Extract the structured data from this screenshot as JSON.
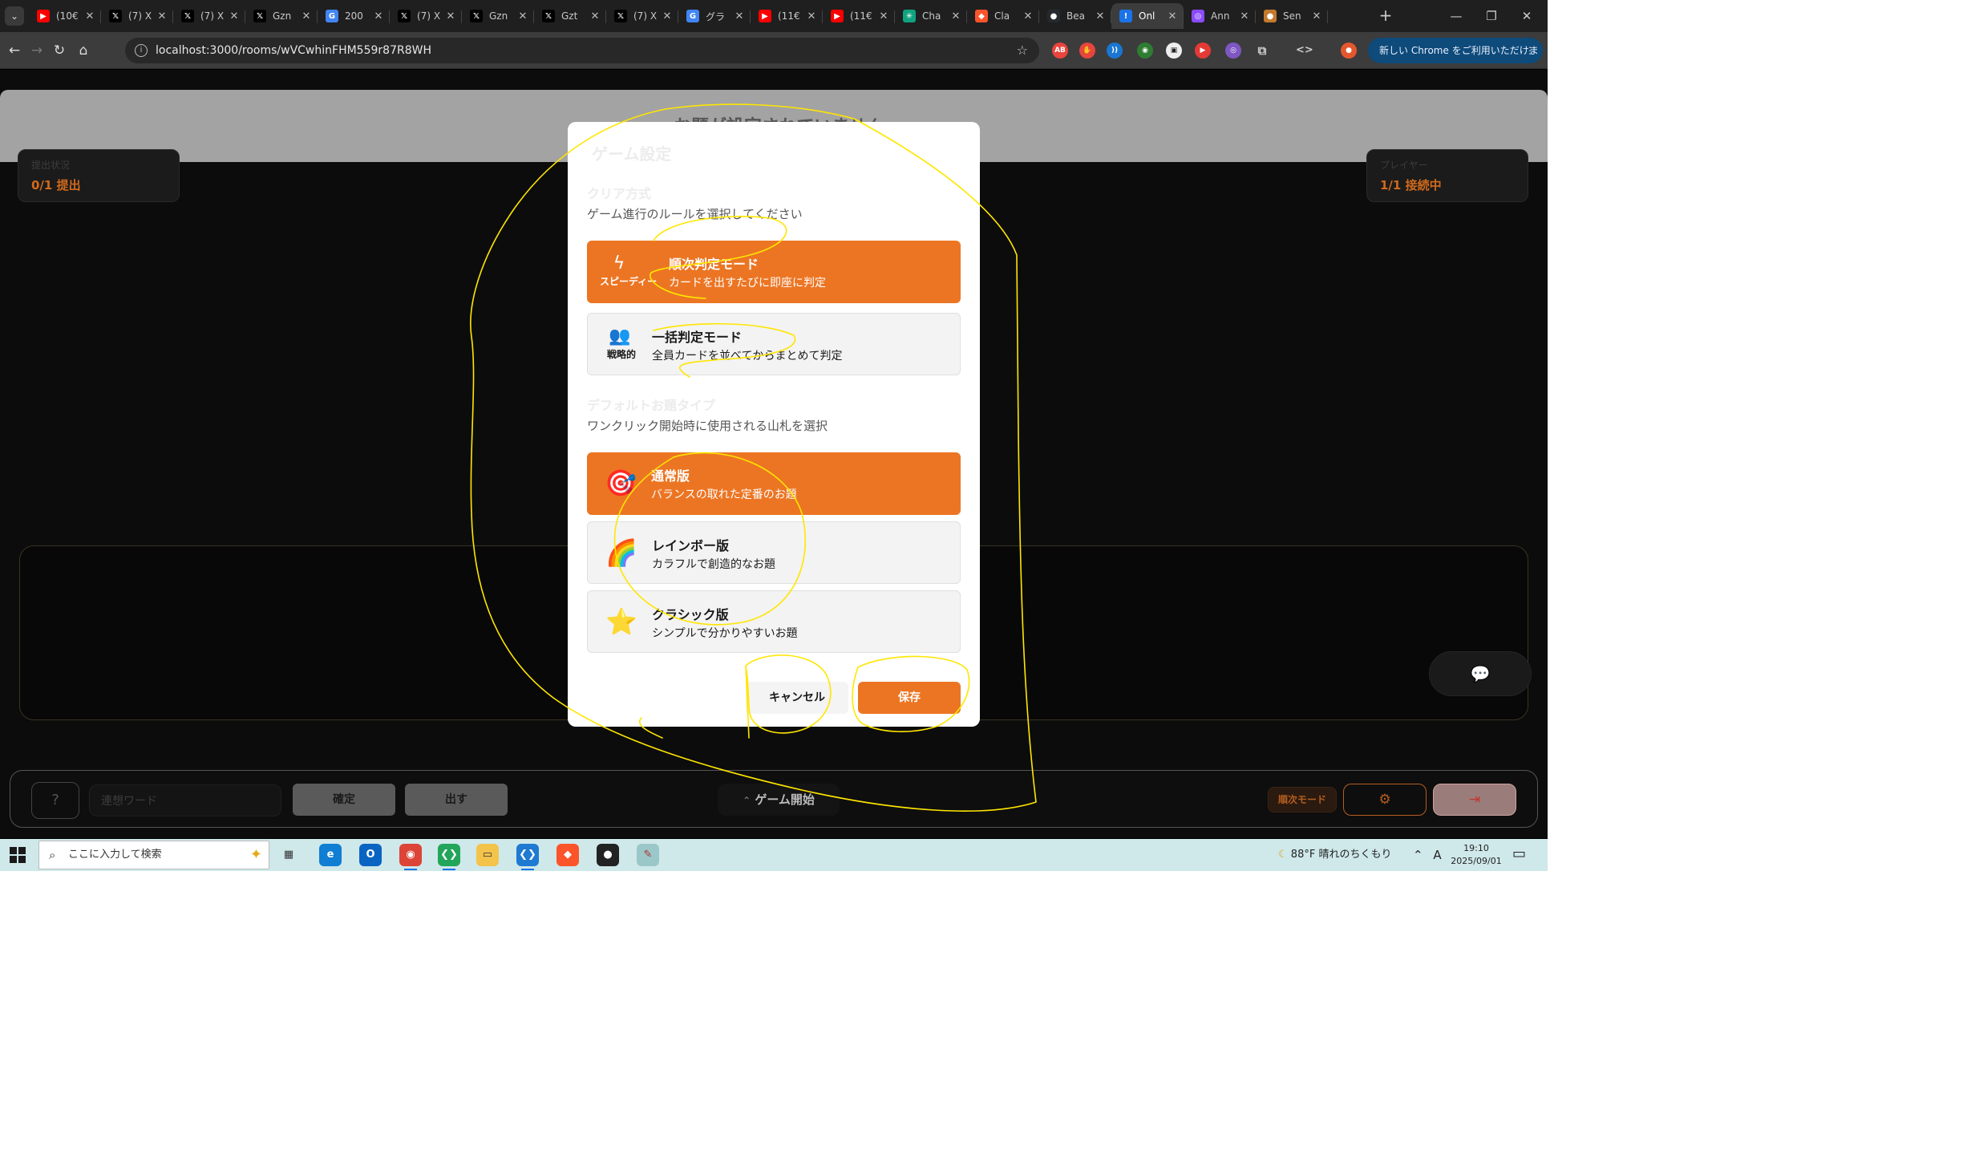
{
  "browser": {
    "tabs": [
      {
        "title": "(10€",
        "icon": "youtube-icon",
        "color": "#ff0000",
        "glyph": "▶"
      },
      {
        "title": "(7) X",
        "icon": "x-logo-icon",
        "color": "#000000",
        "glyph": "𝕏"
      },
      {
        "title": "(7) X",
        "icon": "x-logo-icon",
        "color": "#000000",
        "glyph": "𝕏"
      },
      {
        "title": "Gzn",
        "icon": "x-logo-icon",
        "color": "#000000",
        "glyph": "𝕏"
      },
      {
        "title": "200",
        "icon": "google-icon",
        "color": "#4285f4",
        "glyph": "G"
      },
      {
        "title": "(7) X",
        "icon": "x-logo-icon",
        "color": "#000000",
        "glyph": "𝕏"
      },
      {
        "title": "Gzn",
        "icon": "x-logo-icon",
        "color": "#000000",
        "glyph": "𝕏"
      },
      {
        "title": "Gzt",
        "icon": "x-logo-icon",
        "color": "#000000",
        "glyph": "𝕏"
      },
      {
        "title": "(7) X",
        "icon": "x-logo-icon",
        "color": "#000000",
        "glyph": "𝕏"
      },
      {
        "title": "グラ",
        "icon": "google-icon",
        "color": "#4285f4",
        "glyph": "G"
      },
      {
        "title": "(11€",
        "icon": "youtube-icon",
        "color": "#ff0000",
        "glyph": "▶"
      },
      {
        "title": "(11€",
        "icon": "youtube-icon",
        "color": "#ff0000",
        "glyph": "▶"
      },
      {
        "title": "Cha",
        "icon": "chatgpt-icon",
        "color": "#10a37f",
        "glyph": "✳"
      },
      {
        "title": "Cla",
        "icon": "brave-icon",
        "color": "#fb542b",
        "glyph": "◆"
      },
      {
        "title": "Bea",
        "icon": "github-icon",
        "color": "#24292e",
        "glyph": "●"
      },
      {
        "title": "Onl",
        "icon": "alert-icon",
        "color": "#1a73e8",
        "glyph": "!",
        "active": true
      },
      {
        "title": "Ann",
        "icon": "chrome-icon",
        "color": "#8a4bff",
        "glyph": "◎"
      },
      {
        "title": "Sen",
        "icon": "cookie-icon",
        "color": "#c47a2c",
        "glyph": "●"
      }
    ],
    "url": "localhost:3000/rooms/wVCwhinFHM559r87R8WH",
    "update_label": "新しい Chrome をご利用いただけます"
  },
  "game": {
    "background_title": "お題が設定されていません",
    "submit_card": {
      "label": "提出状況",
      "value": "0/1 提出"
    },
    "player_card": {
      "label": "プレイヤー",
      "value": "1/1 接続中"
    },
    "controls": {
      "help": "?",
      "word_placeholder": "連想ワード",
      "confirm": "確定",
      "play": "出す",
      "start": "ゲーム開始",
      "mode_badge": "順次モード"
    }
  },
  "modal": {
    "title": "ゲーム設定",
    "clear_section": {
      "title": "クリア方式",
      "desc": "ゲーム進行のルールを選択してください",
      "options": [
        {
          "tag": "スピーディー",
          "name": "順次判定モード",
          "desc": "カードを出すたびに即座に判定",
          "selected": true
        },
        {
          "tag": "戦略的",
          "name": "一括判定モード",
          "desc": "全員カードを並べてからまとめて判定",
          "selected": false
        }
      ]
    },
    "deck_section": {
      "title": "デフォルトお題タイプ",
      "desc": "ワンクリック開始時に使用される山札を選択",
      "options": [
        {
          "icon": "🎯",
          "name": "通常版",
          "desc": "バランスの取れた定番のお題",
          "selected": true
        },
        {
          "icon": "🌈",
          "name": "レインボー版",
          "desc": "カラフルで創造的なお題",
          "selected": false
        },
        {
          "icon": "⭐",
          "name": "クラシック版",
          "desc": "シンプルで分かりやすいお題",
          "selected": false
        }
      ]
    },
    "cancel": "キャンセル",
    "save": "保存"
  },
  "taskbar": {
    "search_placeholder": "ここに入力して検索",
    "weather": "88°F  晴れのちくもり",
    "time": "19:10",
    "date": "2025/09/01",
    "ime": "A"
  },
  "colors": {
    "accent": "#ec7523",
    "annotation": "#ffe600"
  }
}
